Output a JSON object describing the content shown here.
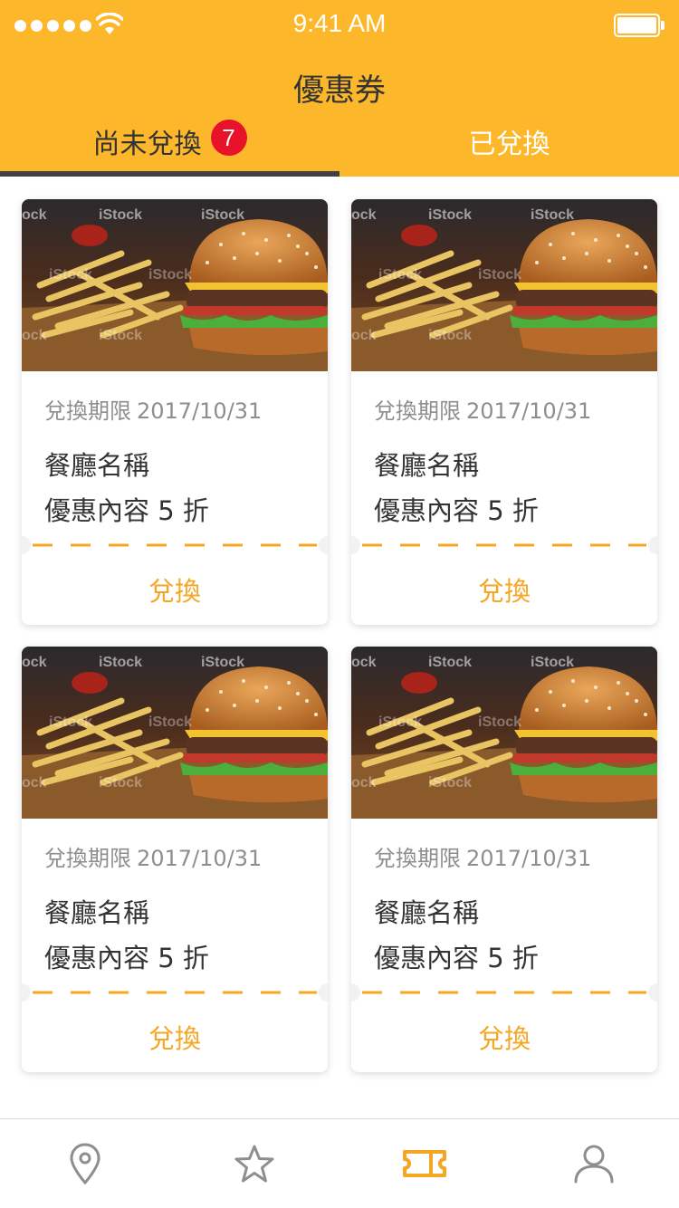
{
  "status_bar": {
    "time": "9:41 AM",
    "signal_icon": "signal-dots-icon",
    "wifi_icon": "wifi-icon",
    "battery_icon": "battery-icon",
    "battery_level": 1.0
  },
  "header": {
    "title": "優惠券",
    "background_color": "#FDB72B"
  },
  "tabs": [
    {
      "label": "尚未兌換",
      "badge": "7",
      "active": true
    },
    {
      "label": "已兌換",
      "active": false
    }
  ],
  "coupons": [
    {
      "image": "burger-fries-photo",
      "deadline_label": "兌換期限",
      "deadline_date": "2017/10/31",
      "restaurant": "餐廳名稱",
      "discount": "優惠內容 5 折",
      "redeem_label": "兌換"
    },
    {
      "image": "burger-fries-photo",
      "deadline_label": "兌換期限",
      "deadline_date": "2017/10/31",
      "restaurant": "餐廳名稱",
      "discount": "優惠內容 5 折",
      "redeem_label": "兌換"
    },
    {
      "image": "burger-fries-photo",
      "deadline_label": "兌換期限",
      "deadline_date": "2017/10/31",
      "restaurant": "餐廳名稱",
      "discount": "優惠內容 5 折",
      "redeem_label": "兌換"
    },
    {
      "image": "burger-fries-photo",
      "deadline_label": "兌換期限",
      "deadline_date": "2017/10/31",
      "restaurant": "餐廳名稱",
      "discount": "優惠內容 5 折",
      "redeem_label": "兌換"
    }
  ],
  "colors": {
    "accent": "#F5A623",
    "badge": "#E8132B",
    "tab_indicator": "#3F4144",
    "nav_inactive": "#8e8e8e"
  },
  "bottom_nav": [
    {
      "icon": "map-pin-icon",
      "active": false
    },
    {
      "icon": "star-icon",
      "active": false
    },
    {
      "icon": "ticket-icon",
      "active": true
    },
    {
      "icon": "user-icon",
      "active": false
    }
  ]
}
